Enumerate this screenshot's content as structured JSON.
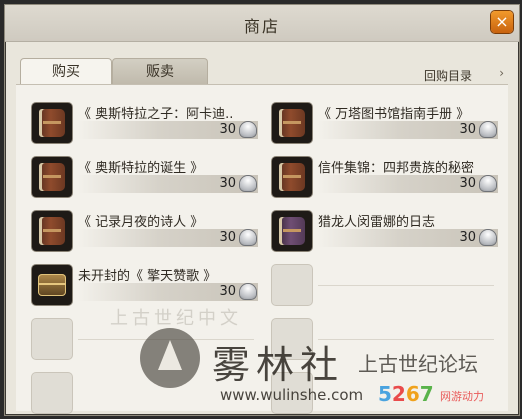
{
  "window": {
    "title": "商店",
    "close_symbol": "×"
  },
  "tabs": [
    {
      "label": "购买",
      "active": true
    },
    {
      "label": "贩卖",
      "active": false
    }
  ],
  "repurchase": {
    "label": "回购目录",
    "chevron": "›"
  },
  "currency_icon": "shell-coin-icon",
  "items": [
    {
      "name": "《 奥斯特拉之子：阿卡迪..",
      "price": "30",
      "icon": "book-brown-icon"
    },
    {
      "name": "《 万塔图书馆指南手册 》",
      "price": "30",
      "icon": "book-brown-icon"
    },
    {
      "name": "《 奥斯特拉的诞生 》",
      "price": "30",
      "icon": "book-brown-icon"
    },
    {
      "name": "信件集锦：四邦贵族的秘密",
      "price": "30",
      "icon": "book-brown-icon"
    },
    {
      "name": "《 记录月夜的诗人 》",
      "price": "30",
      "icon": "book-brown-icon"
    },
    {
      "name": "猎龙人闵雷娜的日志",
      "price": "30",
      "icon": "book-purple-icon"
    },
    {
      "name": "未开封的《 擎天赞歌 》",
      "price": "30",
      "icon": "chest-icon"
    }
  ],
  "watermark": {
    "brand": "雾林社",
    "forum": "上古世纪论坛",
    "url": "www.wulinshe.com",
    "digits": [
      "5",
      "2",
      "6",
      "7"
    ],
    "tag": "网游动力",
    "faint_text": "上古世纪中文"
  }
}
